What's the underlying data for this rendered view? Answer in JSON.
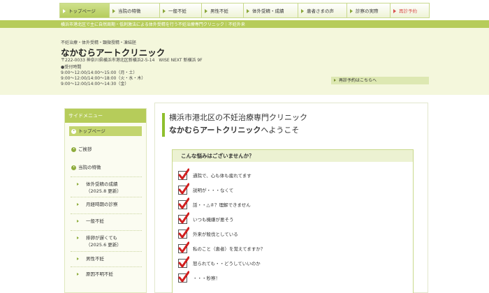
{
  "nav": [
    {
      "label": "トップページ"
    },
    {
      "label": "当院の特徴"
    },
    {
      "label": "一般不妊"
    },
    {
      "label": "男性不妊"
    },
    {
      "label": "体外受精・成績"
    },
    {
      "label": "患者さまの声"
    },
    {
      "label": "診察の実際"
    },
    {
      "label": "再診予約"
    }
  ],
  "band_text": "横浜市港北区で主に自然周期・低刺激法による体外受精を行う不妊治療専門クリニック｜不妊外来",
  "header": {
    "tagline": "不妊治療・体外受精・顕微授精・凍結胚",
    "clinic_name": "なかむらアートクリニック",
    "address": "〒222-0033 神奈川県横浜市港北区新横浜2-5-14　WISE NEXT 新横浜 9F",
    "hours_title": "●受付時間",
    "hours": [
      "9:00～12:00/14:00～15:00（月・土）",
      "9:00～12:00/14:00～18:00（火・水・木）",
      "9:00～12:00/14:00～14:30（金）"
    ],
    "reserve_link": "再診予約はこちらへ"
  },
  "sidebar": {
    "title": "サイドメニュー",
    "items": [
      {
        "label": "トップページ"
      },
      {
        "label": "ご挨拶"
      },
      {
        "label": "当院の特徴"
      }
    ],
    "sub_items": [
      {
        "line1": "体外受精の成績",
        "line2": "（2025.8 更新）"
      },
      {
        "line1": "月経時期の診察",
        "line2": ""
      },
      {
        "line1": "一般不妊",
        "line2": ""
      },
      {
        "line1": "排卵が遅くても",
        "line2": "（2025.6 更新）"
      },
      {
        "line1": "男性不妊",
        "line2": ""
      },
      {
        "line1": "原因不明不妊",
        "line2": ""
      }
    ]
  },
  "main": {
    "title1": "横浜市港北区の不妊治療専門クリニック",
    "title2_bold": "なかむらアートクリニック",
    "title2_rest": "へようこそ",
    "worries_title": "こんな悩みはございませんか？",
    "worries": [
      "通院で、心も体も疲れてます",
      "説明が・・・なくて",
      "話・・△＃？理解できません",
      "いつも機嫌が悪そう",
      "外来が殺伐としている",
      "私のこと（患者）を覚えてますか？",
      "怒られても・・どうしていいのか",
      "・・・秒察！"
    ]
  },
  "colors": {
    "accent_green": "#b6cc5a",
    "header_bg": "#f4f7dc",
    "check_red": "#d11f1f",
    "reserve_red": "#d9534f"
  }
}
